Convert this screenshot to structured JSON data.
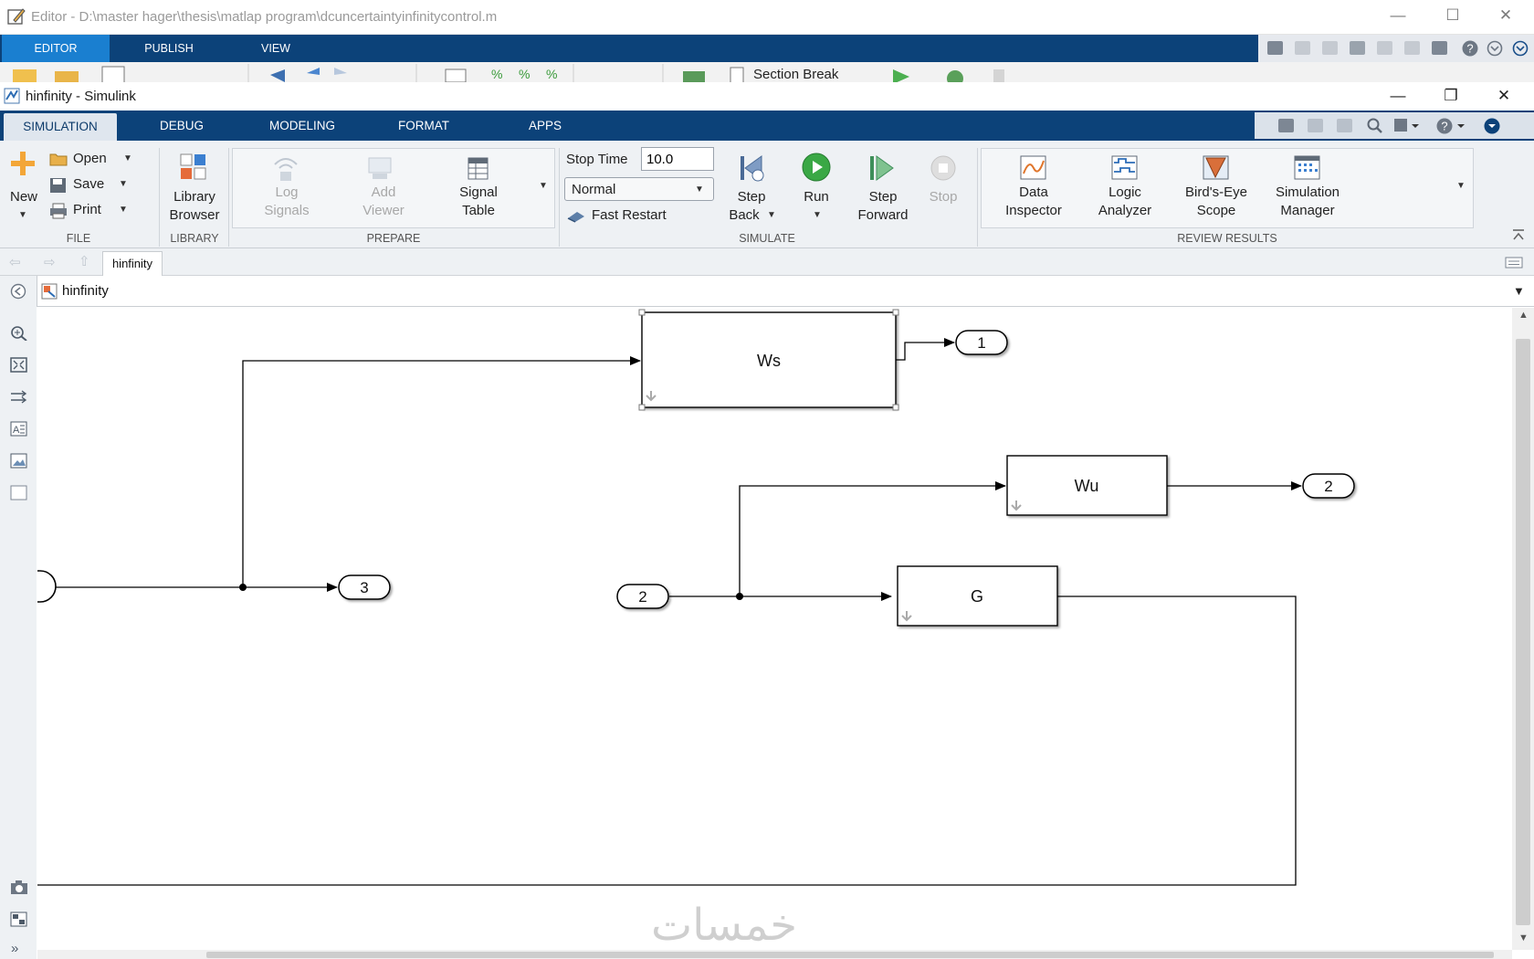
{
  "editor": {
    "title": "Editor - D:\\master hager\\thesis\\matlap program\\dcuncertaintyinfinitycontrol.m",
    "tabs": [
      "EDITOR",
      "PUBLISH",
      "VIEW"
    ],
    "active_tab": "EDITOR",
    "toolstrip_partial": "Section Break",
    "window_controls": [
      "—",
      "☐",
      "✕"
    ]
  },
  "simulink": {
    "title": "hinfinity - Simulink",
    "window_controls": [
      "—",
      "❐",
      "✕"
    ],
    "tabs": [
      "SIMULATION",
      "DEBUG",
      "MODELING",
      "FORMAT",
      "APPS"
    ],
    "active_tab": "SIMULATION",
    "ribbon": {
      "file": {
        "group_label": "FILE",
        "new_label": "New",
        "open_label": "Open",
        "save_label": "Save",
        "print_label": "Print"
      },
      "library": {
        "group_label": "LIBRARY",
        "browser_label_1": "Library",
        "browser_label_2": "Browser"
      },
      "prepare": {
        "group_label": "PREPARE",
        "log_signals_1": "Log",
        "log_signals_2": "Signals",
        "add_viewer_1": "Add",
        "add_viewer_2": "Viewer",
        "signal_table_1": "Signal",
        "signal_table_2": "Table"
      },
      "simulate": {
        "group_label": "SIMULATE",
        "stop_time_label": "Stop Time",
        "stop_time_value": "10.0",
        "mode_value": "Normal",
        "fast_restart_label": "Fast Restart",
        "step_back_1": "Step",
        "step_back_2": "Back",
        "run_label": "Run",
        "step_forward_1": "Step",
        "step_forward_2": "Forward",
        "stop_label": "Stop"
      },
      "review": {
        "group_label": "REVIEW RESULTS",
        "data_inspector_1": "Data",
        "data_inspector_2": "Inspector",
        "logic_analyzer_1": "Logic",
        "logic_analyzer_2": "Analyzer",
        "birds_eye_1": "Bird's-Eye",
        "birds_eye_2": "Scope",
        "sim_manager_1": "Simulation",
        "sim_manager_2": "Manager"
      }
    },
    "nav_tab_label": "hinfinity",
    "breadcrumb": "hinfinity",
    "diagram": {
      "blocks": {
        "ws": "Ws",
        "wu": "Wu",
        "g": "G"
      },
      "outports": {
        "out1": "1",
        "out2": "2",
        "out3": "3"
      },
      "inports": {
        "in2": "2"
      }
    },
    "watermark": "خمسات"
  },
  "colors": {
    "tabstrip": "#0c4279",
    "editor_active_tab": "#1a7fd0",
    "ribbon_bg": "#eef1f4",
    "run_green": "#3aa845"
  }
}
